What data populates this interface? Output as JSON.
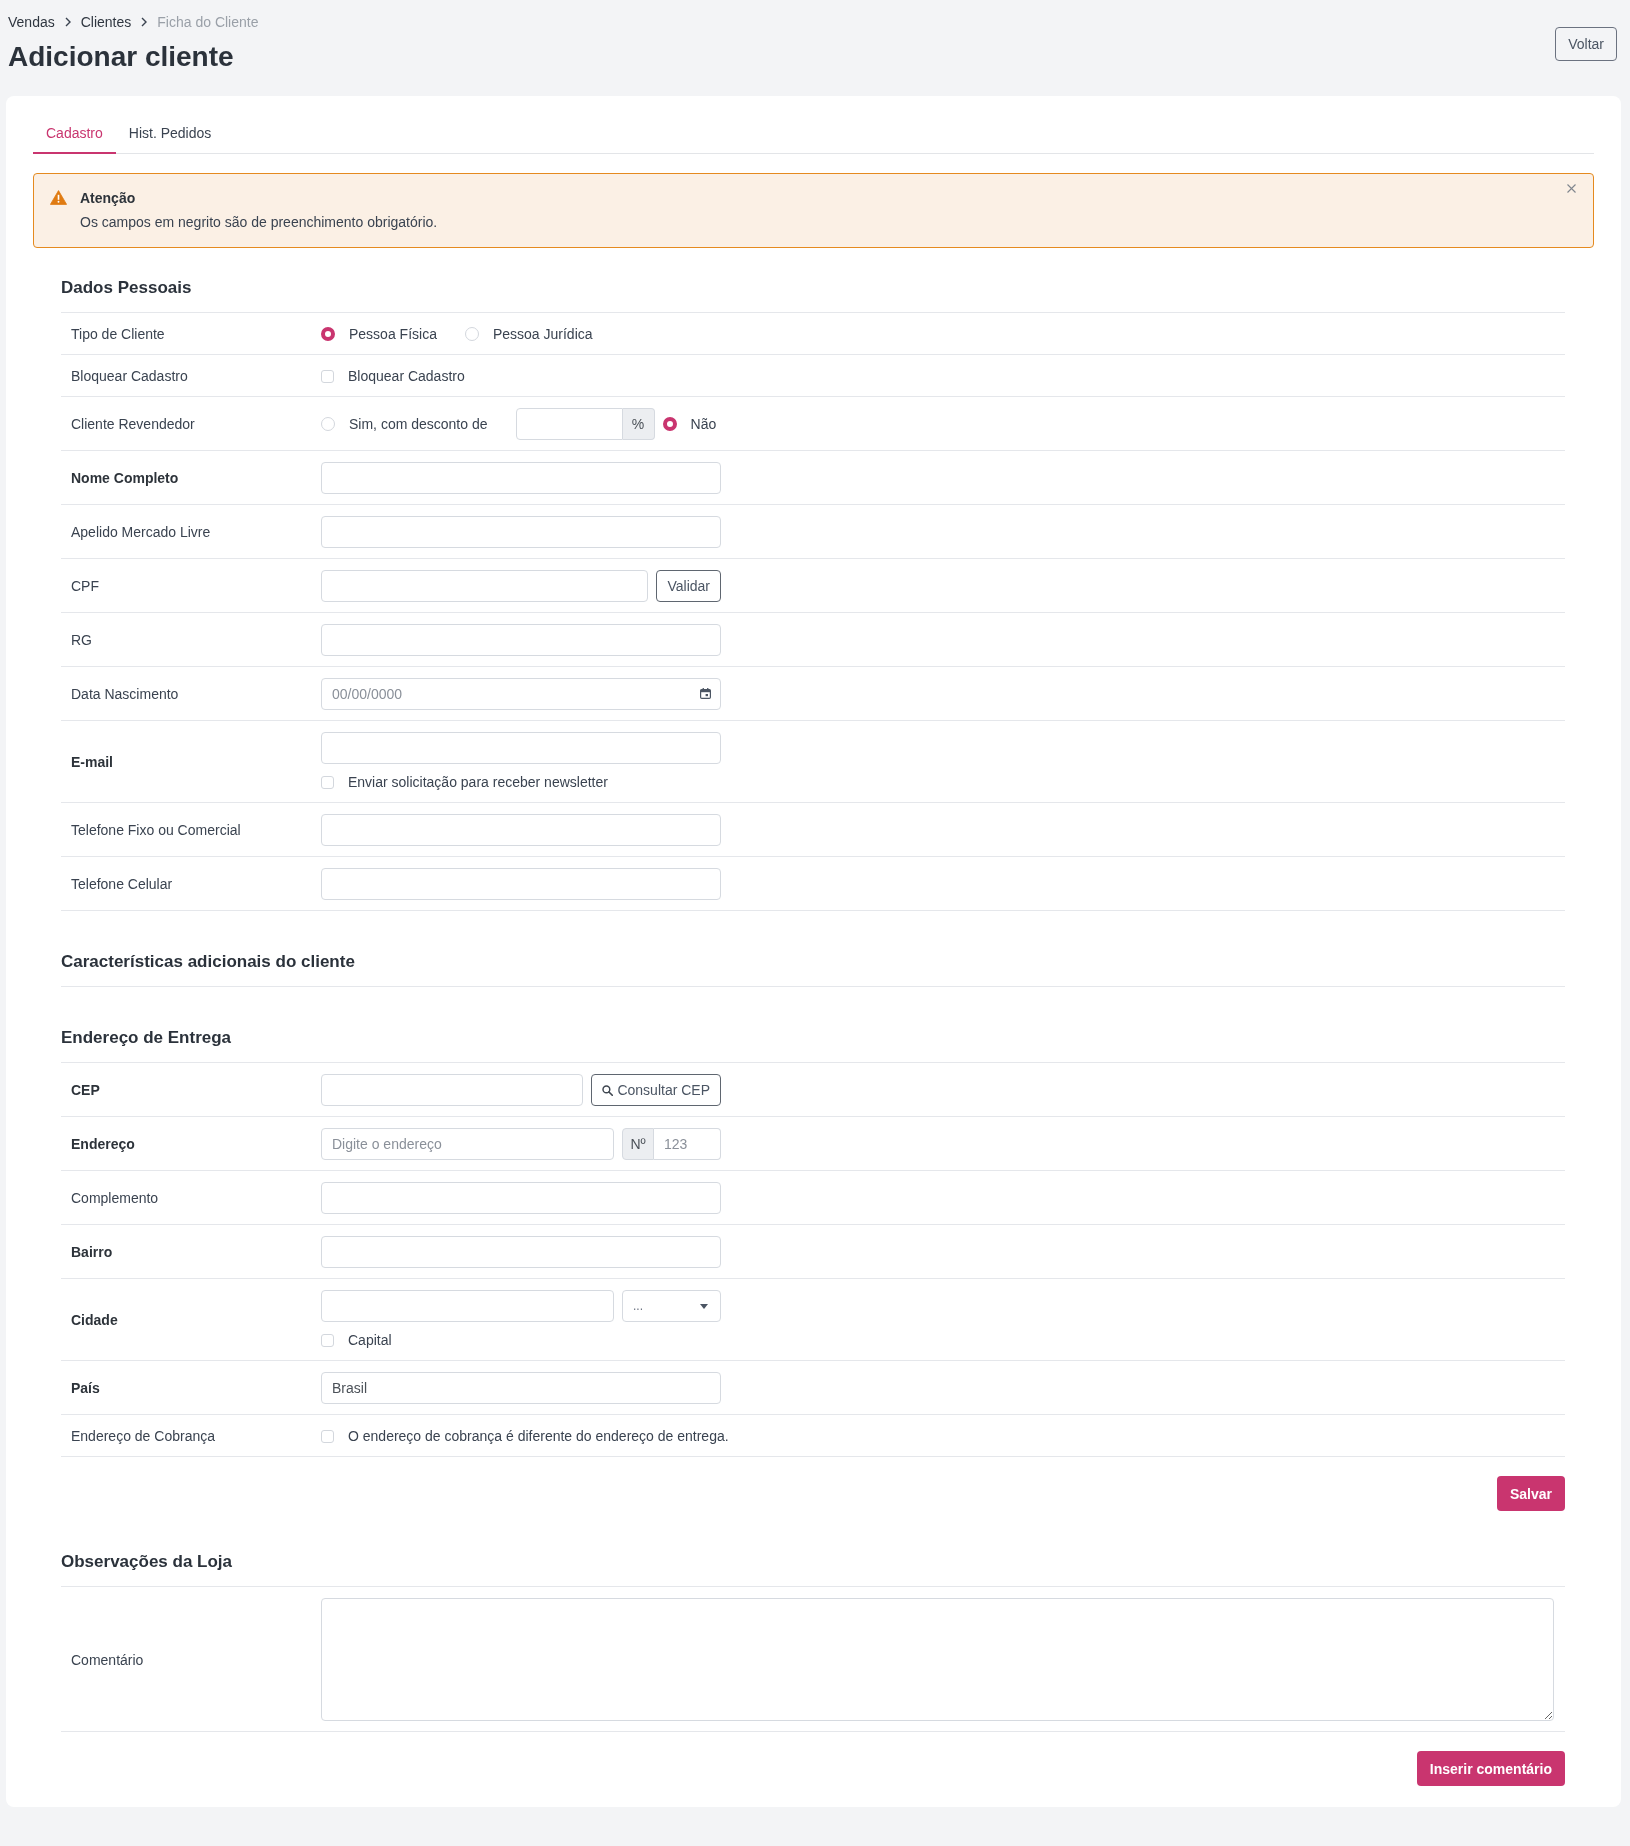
{
  "breadcrumb": [
    {
      "label": "Vendas",
      "current": false
    },
    {
      "label": "Clientes",
      "current": false
    },
    {
      "label": "Ficha do Cliente",
      "current": true
    }
  ],
  "page_title": "Adicionar cliente",
  "back_button": "Voltar",
  "tabs": [
    {
      "label": "Cadastro",
      "selected": true
    },
    {
      "label": "Hist. Pedidos",
      "selected": false
    }
  ],
  "alert": {
    "title": "Atenção",
    "message": "Os campos em negrito são de preenchimento obrigatório."
  },
  "sections": [
    {
      "title": "Dados Pessoais",
      "rows": [
        {
          "label": "Tipo de Cliente",
          "required": false,
          "lines": [
            [
              {
                "kind": "radio",
                "label": "Pessoa Física",
                "selected": true
              },
              {
                "kind": "radio",
                "label": "Pessoa Jurídica",
                "selected": false
              }
            ]
          ]
        },
        {
          "label": "Bloquear Cadastro",
          "required": false,
          "lines": [
            [
              {
                "kind": "checkbox",
                "label": "Bloquear Cadastro",
                "checked": false
              }
            ]
          ]
        },
        {
          "label": "Cliente Revendedor",
          "required": false,
          "lines": [
            [
              {
                "kind": "radio",
                "label": "Sim, com desconto de",
                "selected": false
              },
              {
                "kind": "input",
                "addon_after": "%"
              },
              {
                "kind": "radio",
                "label": "Não",
                "selected": true
              }
            ]
          ]
        },
        {
          "label": "Nome Completo",
          "required": true,
          "lines": [
            [
              {
                "kind": "input"
              }
            ]
          ]
        },
        {
          "label": "Apelido Mercado Livre",
          "required": false,
          "lines": [
            [
              {
                "kind": "input"
              }
            ]
          ]
        },
        {
          "label": "CPF",
          "required": false,
          "lines": [
            [
              {
                "kind": "input"
              },
              {
                "kind": "button",
                "label": "Validar"
              }
            ]
          ]
        },
        {
          "label": "RG",
          "required": false,
          "lines": [
            [
              {
                "kind": "input"
              }
            ]
          ]
        },
        {
          "label": "Data Nascimento",
          "required": false,
          "lines": [
            [
              {
                "kind": "date",
                "placeholder": "00/00/0000"
              }
            ]
          ]
        },
        {
          "label": "E-mail",
          "required": true,
          "lines": [
            [
              {
                "kind": "input"
              }
            ],
            [
              {
                "kind": "checkbox",
                "label": "Enviar solicitação para receber newsletter",
                "checked": false
              }
            ]
          ]
        },
        {
          "label": "Telefone Fixo ou Comercial",
          "required": false,
          "lines": [
            [
              {
                "kind": "input"
              }
            ]
          ]
        },
        {
          "label": "Telefone Celular",
          "required": false,
          "lines": [
            [
              {
                "kind": "input"
              }
            ]
          ]
        }
      ]
    },
    {
      "title": "Características adicionais do cliente"
    },
    {
      "title": "Endereço de Entrega",
      "rows": [
        {
          "label": "CEP",
          "required": true,
          "lines": [
            [
              {
                "kind": "input"
              },
              {
                "kind": "lookup",
                "label": "Consultar CEP"
              }
            ]
          ]
        },
        {
          "label": "Endereço",
          "required": true,
          "lines": [
            [
              {
                "kind": "input",
                "placeholder": "Digite o endereço"
              },
              {
                "kind": "input",
                "addon_before": "Nº",
                "placeholder": "123"
              }
            ]
          ]
        },
        {
          "label": "Complemento",
          "required": false,
          "lines": [
            [
              {
                "kind": "input"
              }
            ]
          ]
        },
        {
          "label": "Bairro",
          "required": true,
          "lines": [
            [
              {
                "kind": "input"
              }
            ]
          ]
        },
        {
          "label": "Cidade",
          "required": true,
          "lines": [
            [
              {
                "kind": "input"
              },
              {
                "kind": "select",
                "value": "..."
              }
            ],
            [
              {
                "kind": "checkbox",
                "label": "Capital",
                "checked": false
              }
            ]
          ]
        },
        {
          "label": "País",
          "required": true,
          "lines": [
            [
              {
                "kind": "input",
                "value": "Brasil"
              }
            ]
          ]
        },
        {
          "label": "Endereço de Cobrança",
          "required": false,
          "lines": [
            [
              {
                "kind": "checkbox",
                "label": "O endereço de cobrança é diferente do endereço de entrega.",
                "checked": false
              }
            ]
          ]
        }
      ],
      "button": "Salvar"
    },
    {
      "title": "Observações da Loja",
      "rows": [
        {
          "label": "Comentário",
          "required": false,
          "lines": [
            [
              {
                "kind": "textarea"
              }
            ]
          ]
        }
      ],
      "button": "Inserir comentário"
    }
  ]
}
